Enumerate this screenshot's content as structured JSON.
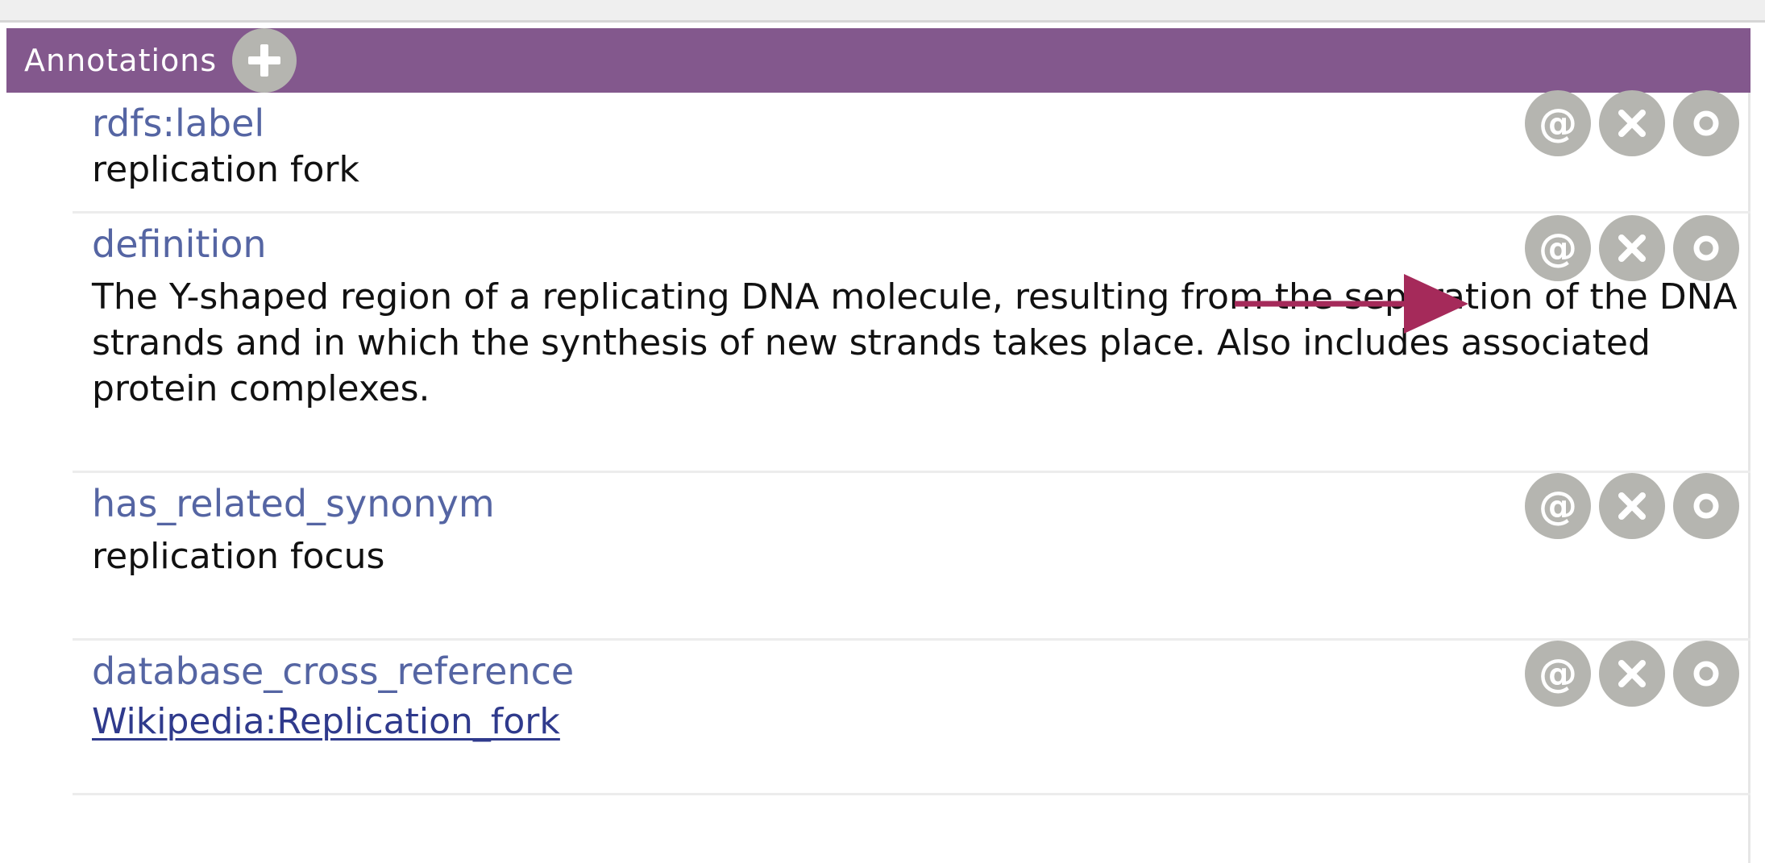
{
  "panel": {
    "title": "Annotations",
    "header_color": "#83588d",
    "add_icon": "plus-icon"
  },
  "annotations": [
    {
      "property": "rdfs:label",
      "value": "replication fork",
      "is_link": false
    },
    {
      "property": "definition",
      "value": "The Y-shaped region of a replicating DNA molecule, resulting from the separation of the DNA strands and in which the synthesis of new strands takes place. Also includes associated protein complexes.",
      "is_link": false
    },
    {
      "property": "has_related_synonym",
      "value": "replication focus",
      "is_link": false
    },
    {
      "property": "database_cross_reference",
      "value": "Wikipedia:Replication_fork",
      "is_link": true
    }
  ],
  "row_buttons": {
    "annotate_glyph": "@",
    "annotate_icon": "at-icon",
    "delete_icon": "close-icon",
    "edit_icon": "circle-icon",
    "button_color": "#b5b5b0"
  },
  "callout": {
    "icon": "arrow-right-icon",
    "color": "#a52a5a"
  }
}
